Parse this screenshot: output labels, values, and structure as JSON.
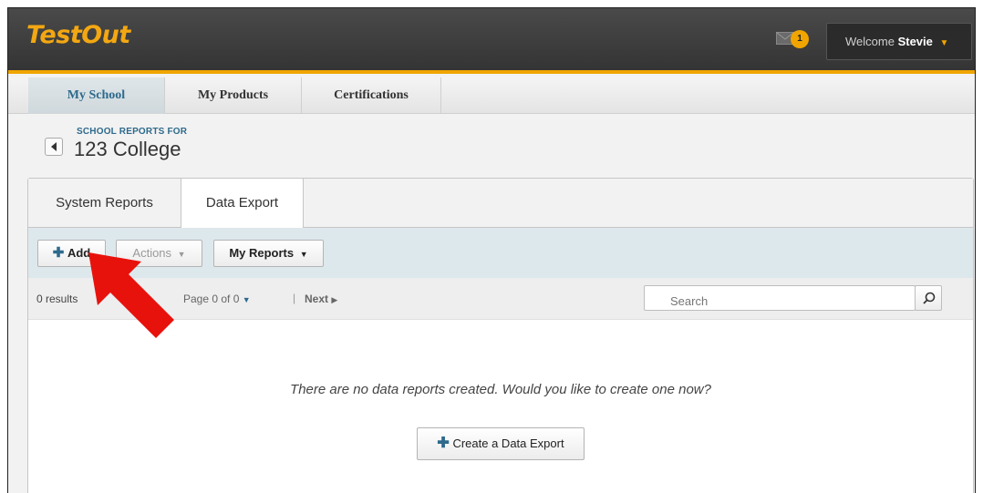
{
  "header": {
    "logo": "TestOut",
    "notification_count": "1",
    "welcome_label": "Welcome",
    "user_name": "Stevie"
  },
  "nav": {
    "tabs": [
      {
        "label": "My School"
      },
      {
        "label": "My Products"
      },
      {
        "label": "Certifications"
      }
    ],
    "active": "My School"
  },
  "page": {
    "subtitle": "SCHOOL REPORTS FOR",
    "title": "123 College"
  },
  "panel": {
    "tabs": [
      {
        "label": "System Reports"
      },
      {
        "label": "Data Export"
      }
    ],
    "active_tab": "Data Export",
    "toolbar": {
      "add_label": "Add",
      "actions_label": "Actions",
      "my_reports_label": "My Reports"
    },
    "pager": {
      "results": "0 results",
      "page": "Page 0 of 0",
      "separator": "|",
      "next": "Next"
    },
    "search": {
      "placeholder": "Search"
    },
    "empty_message": "There are no data reports created. Would you like to create one now?",
    "create_label": "Create a Data Export"
  },
  "colors": {
    "brand": "#f3a712",
    "accent": "#2d6a8c",
    "annotation_arrow": "#e8120c"
  },
  "icons": [
    "envelope-icon",
    "back-arrow-icon",
    "plus-icon",
    "caret-down-icon",
    "caret-right-icon",
    "search-icon"
  ]
}
